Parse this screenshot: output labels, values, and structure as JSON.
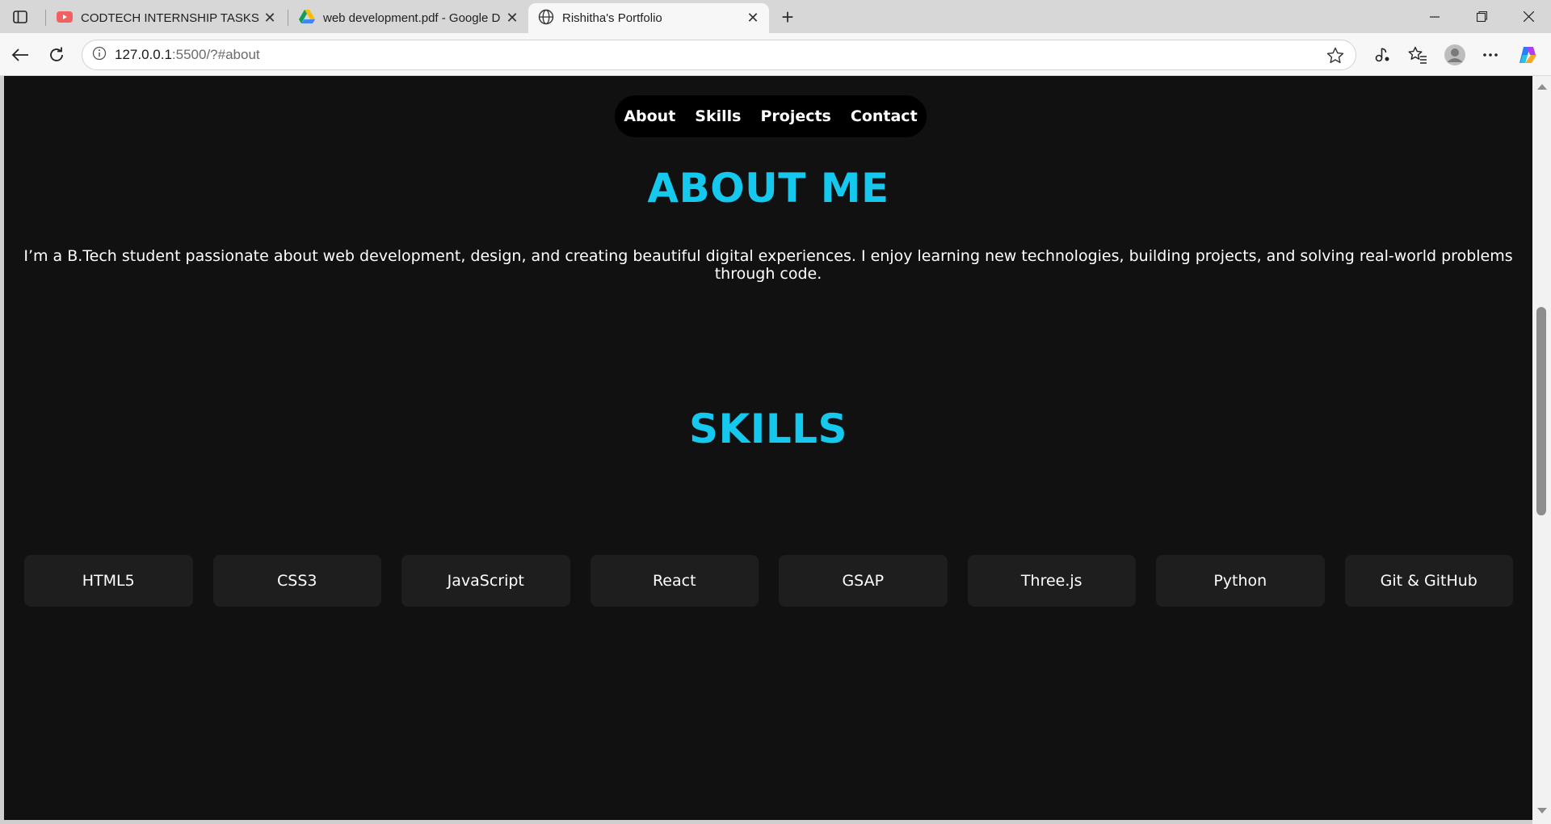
{
  "browser": {
    "tabs": [
      {
        "title": "CODTECH INTERNSHIP TASKS GU",
        "icon": "youtube-icon",
        "active": false
      },
      {
        "title": "web development.pdf - Google D",
        "icon": "google-drive-icon",
        "active": false
      },
      {
        "title": "Rishitha's Portfolio",
        "icon": "globe-icon",
        "active": true
      }
    ],
    "address": {
      "host": "127.0.0.1",
      "rest": ":5500/?#about"
    }
  },
  "page": {
    "nav": [
      "About",
      "Skills",
      "Projects",
      "Contact"
    ],
    "about": {
      "title": "ABOUT ME",
      "text": "I’m a B.Tech student passionate about web development, design, and creating beautiful digital experiences. I enjoy learning new technologies, building projects, and solving real-world problems through code."
    },
    "skills": {
      "title": "SKILLS",
      "items": [
        "HTML5",
        "CSS3",
        "JavaScript",
        "React",
        "GSAP",
        "Three.js",
        "Python",
        "Git & GitHub"
      ]
    },
    "colors": {
      "accent": "#14c8ee",
      "background": "#111111",
      "card": "#1e1e1e"
    }
  }
}
